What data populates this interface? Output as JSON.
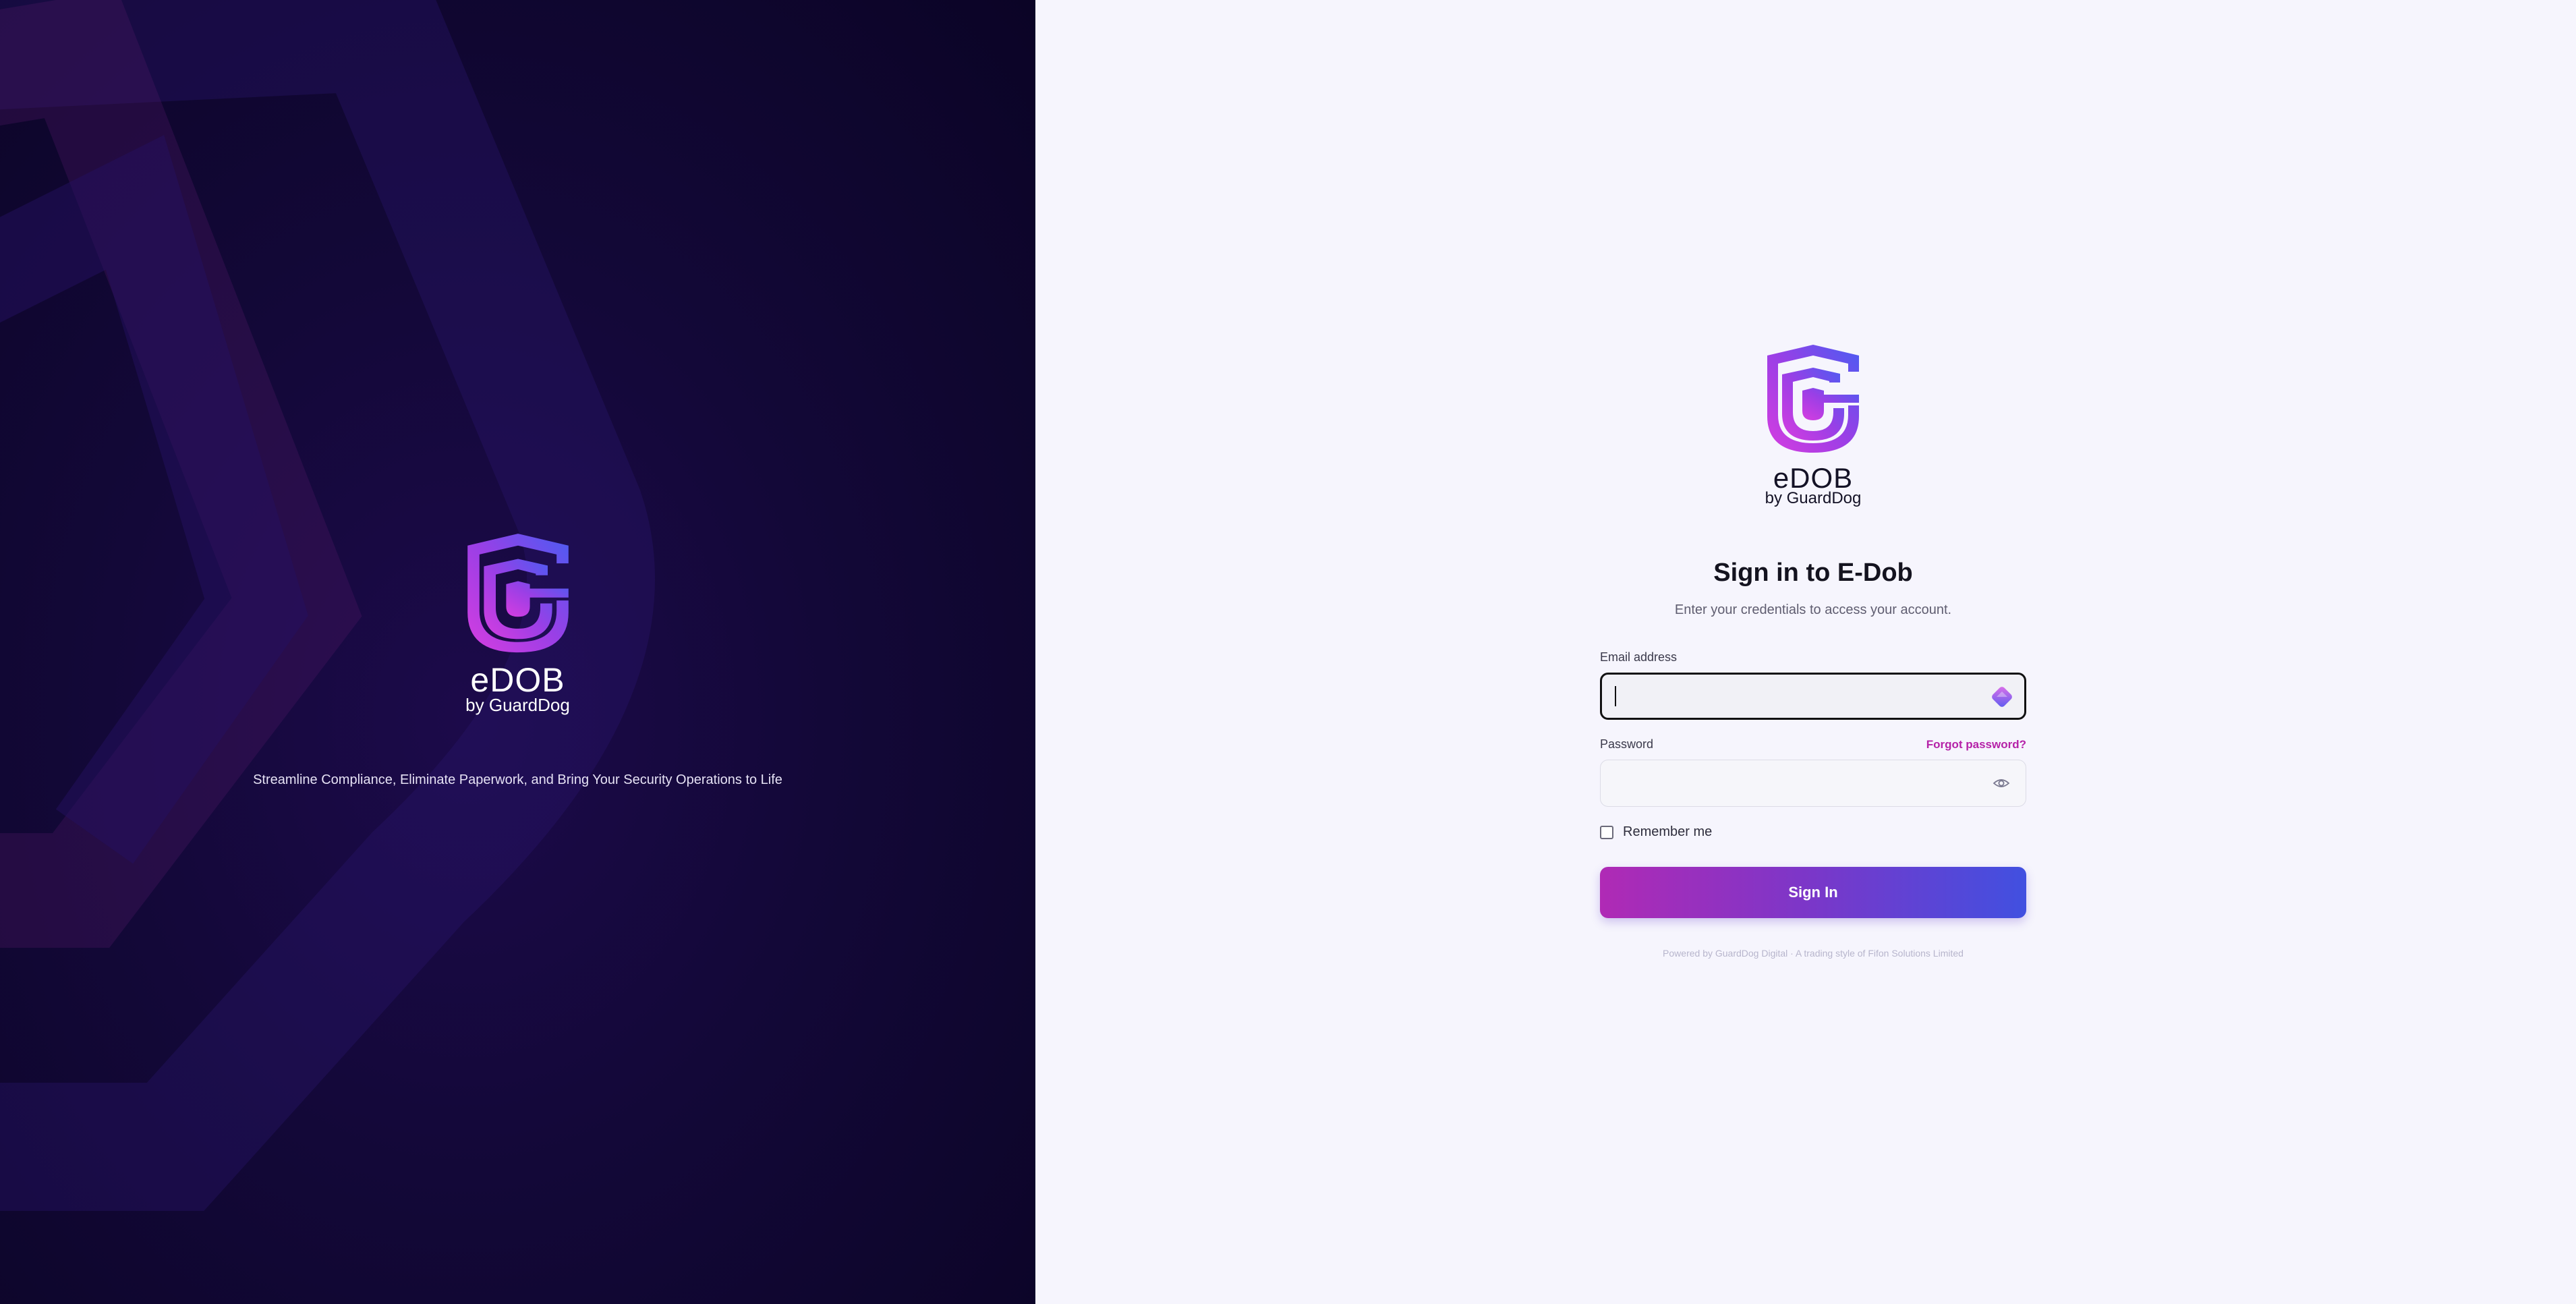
{
  "colors": {
    "left_bg": "#130838",
    "right_bg": "#f6f5fd",
    "accent_magenta": "#b522a8",
    "accent_blue": "#4150e0"
  },
  "branding": {
    "logo_icon": "shield-c-logo",
    "wordmark": "eDOB",
    "byline": "by GuardDog",
    "tagline": "Streamline Compliance, Eliminate Paperwork, and Bring Your Security Operations to Life"
  },
  "login": {
    "title": "Sign in to E-Dob",
    "subtitle": "Enter your credentials to access your account.",
    "email_label": "Email address",
    "email_value": "",
    "email_extension_icon": "password-manager-icon",
    "password_label": "Password",
    "password_value": "",
    "forgot_password": "Forgot password?",
    "password_toggle_icon": "eye-icon",
    "remember_me": "Remember me",
    "remember_checked": false,
    "sign_in": "Sign In",
    "footer": "Powered by GuardDog Digital · A trading style of Fifon Solutions Limited"
  }
}
